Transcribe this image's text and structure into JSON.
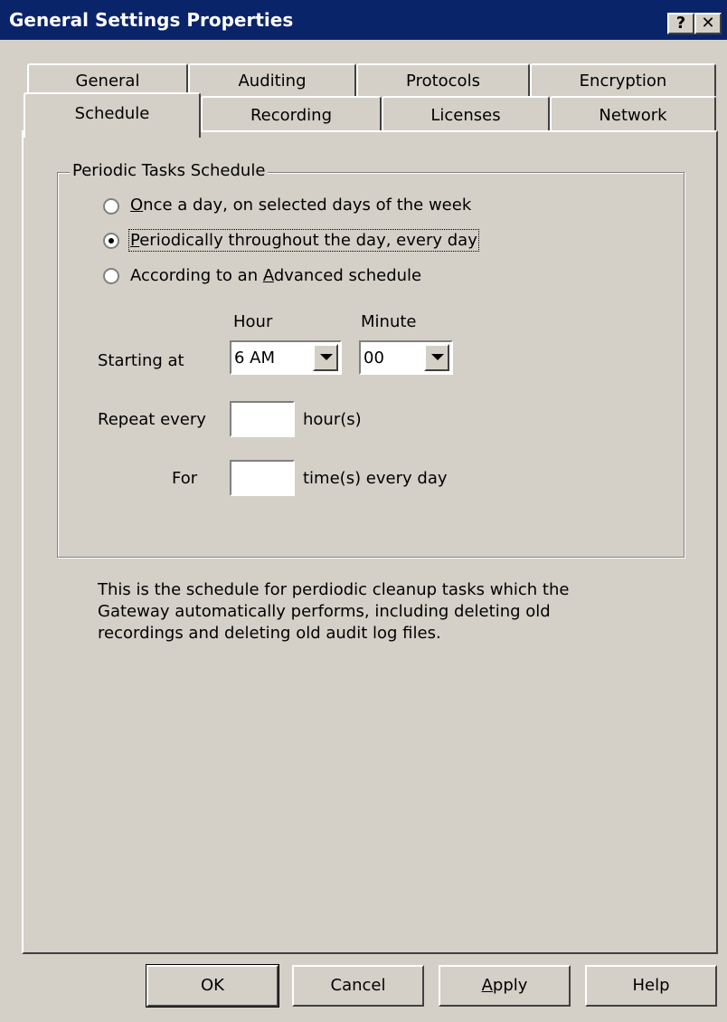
{
  "window": {
    "title": "General Settings Properties",
    "help_glyph": "?",
    "close_glyph": "✕"
  },
  "tabs": {
    "back_row": [
      "General",
      "Auditing",
      "Protocols",
      "Encryption"
    ],
    "front_row": [
      "Schedule",
      "Recording",
      "Licenses",
      "Network"
    ],
    "selected": "Schedule"
  },
  "group": {
    "label": "Periodic Tasks Schedule"
  },
  "radios": {
    "once": {
      "prefix": "",
      "accel": "O",
      "rest": "nce a day, on selected days of the week",
      "checked": false
    },
    "periodic": {
      "prefix": "",
      "accel": "P",
      "rest": "eriodically throughout the day, every day",
      "checked": true
    },
    "advanced": {
      "prefix": "According to an ",
      "accel": "A",
      "rest": "dvanced schedule",
      "checked": false
    }
  },
  "starting": {
    "hour_header": "Hour",
    "minute_header": "Minute",
    "label": "Starting at",
    "hour_value": "6 AM",
    "minute_value": "00"
  },
  "repeat": {
    "label": "Repeat every",
    "value": "",
    "unit": "hour(s)"
  },
  "for": {
    "label": "For",
    "value": "",
    "unit": "time(s) every day"
  },
  "description": "This is the schedule for perdiodic cleanup tasks which the Gateway automatically performs, including deleting old recordings and deleting old audit log files.",
  "buttons": {
    "ok": "OK",
    "cancel": "Cancel",
    "apply_accel": "A",
    "apply_rest": "pply",
    "help": "Help"
  },
  "colors": {
    "titlebar": "#0a246a",
    "face": "#d4d0c8"
  }
}
